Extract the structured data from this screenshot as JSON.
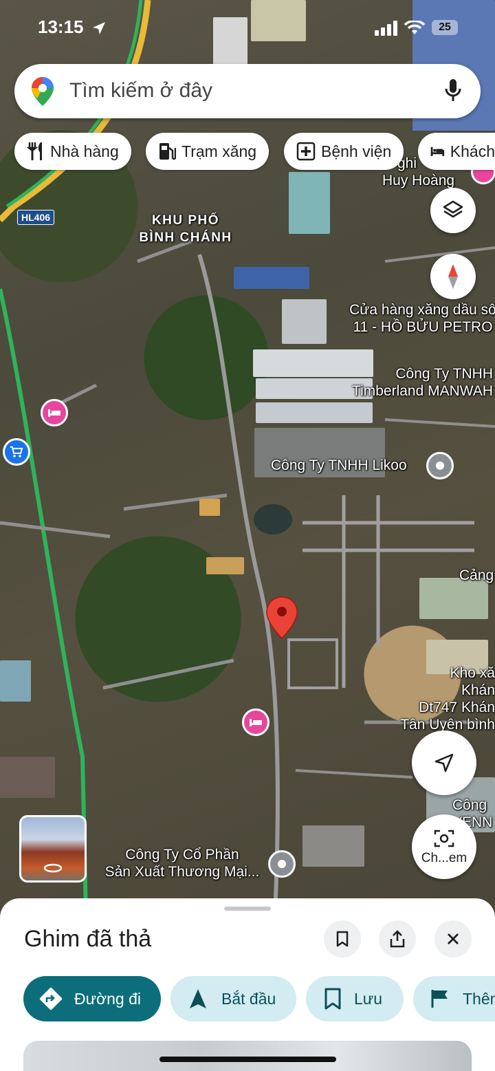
{
  "status_bar": {
    "time": "13:15",
    "battery": "25"
  },
  "search": {
    "placeholder": "Tìm kiếm ở đây"
  },
  "chips": [
    {
      "label": "Nhà hàng",
      "icon": "fork-knife-icon"
    },
    {
      "label": "Trạm xăng",
      "icon": "gas-station-icon"
    },
    {
      "label": "Bệnh viện",
      "icon": "hospital-icon"
    },
    {
      "label": "Khách",
      "icon": "bed-icon"
    }
  ],
  "map": {
    "road_shield": "HL406",
    "area_label": [
      "KHU PHỐ",
      "BÌNH CHÁNH"
    ],
    "places": [
      {
        "lines": [
          "ghi",
          "Huy Hoàng"
        ]
      },
      {
        "lines": [
          "Cửa hàng xăng dầu sô",
          "11 - HỒ BỬU PETRO"
        ]
      },
      {
        "lines": [
          "Công Ty TNHH",
          "Timberland MANWAH"
        ]
      },
      {
        "lines": [
          "Công Ty TNHH Likoo"
        ]
      },
      {
        "lines": [
          "Cảng"
        ]
      },
      {
        "lines": [
          "Kho xă",
          "Khán",
          "Dt747 Khán",
          "Tân Uyên bình"
        ]
      },
      {
        "lines": [
          "Công",
          "VENN"
        ]
      },
      {
        "lines": [
          "Công Ty Cổ Phần",
          "Sản Xuất Thương Mại..."
        ]
      }
    ],
    "camera_label": "Ch...em"
  },
  "sheet": {
    "title": "Ghim đã thả",
    "actions": [
      {
        "label": "Đường đi",
        "icon": "directions-icon"
      },
      {
        "label": "Bắt đầu",
        "icon": "navigation-arrow-icon"
      },
      {
        "label": "Lưu",
        "icon": "bookmark-icon"
      },
      {
        "label": "Thêm",
        "icon": "flag-icon"
      }
    ]
  },
  "colors": {
    "accent": "#0b6e7a",
    "chip_bg": "#d2ecf1",
    "pin": "#ea4335",
    "hotel": "#e8469d",
    "shop": "#1a73e8"
  }
}
